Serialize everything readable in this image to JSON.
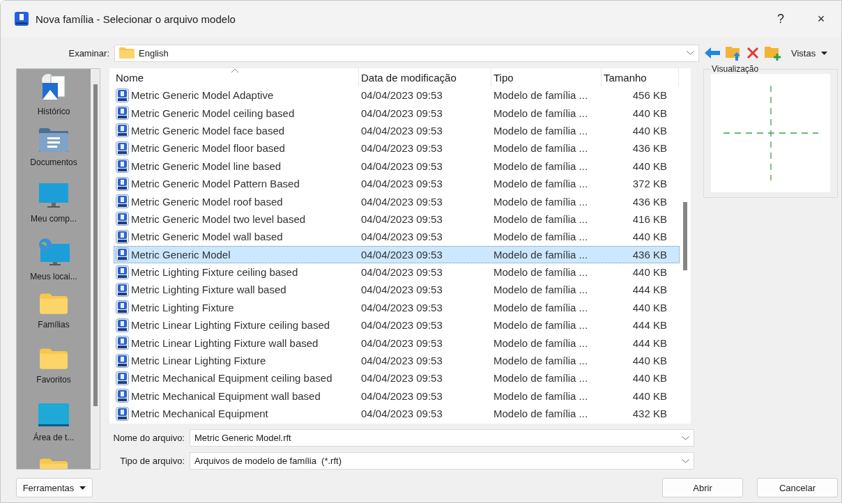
{
  "window": {
    "title": "Nova família - Selecionar o arquivo modelo",
    "help": "?",
    "close": "×"
  },
  "look_in": {
    "label": "Examinar:",
    "value": "English"
  },
  "toolbar": {
    "views": "Vistas"
  },
  "sidebar": {
    "items": [
      {
        "label": "Histórico",
        "kind": "history"
      },
      {
        "label": "Documentos",
        "kind": "documents"
      },
      {
        "label": "Meu comp...",
        "kind": "computer"
      },
      {
        "label": "Meus locai...",
        "kind": "network"
      },
      {
        "label": "Famílias",
        "kind": "folder"
      },
      {
        "label": "Favoritos",
        "kind": "folder"
      },
      {
        "label": "Área de t...",
        "kind": "desktop"
      },
      {
        "kind": "folder"
      }
    ]
  },
  "table": {
    "columns": [
      "Nome",
      "Data de modificação",
      "Tipo",
      "Tamanho"
    ],
    "rows": [
      {
        "name": "Metric Generic Model Adaptive",
        "date": "04/04/2023 09:53",
        "type": "Modelo de família ...",
        "size": "456 KB",
        "selected": false
      },
      {
        "name": "Metric Generic Model ceiling based",
        "date": "04/04/2023 09:53",
        "type": "Modelo de família ...",
        "size": "440 KB",
        "selected": false
      },
      {
        "name": "Metric Generic Model face based",
        "date": "04/04/2023 09:53",
        "type": "Modelo de família ...",
        "size": "440 KB",
        "selected": false
      },
      {
        "name": "Metric Generic Model floor based",
        "date": "04/04/2023 09:53",
        "type": "Modelo de família ...",
        "size": "436 KB",
        "selected": false
      },
      {
        "name": "Metric Generic Model line based",
        "date": "04/04/2023 09:53",
        "type": "Modelo de família ...",
        "size": "440 KB",
        "selected": false
      },
      {
        "name": "Metric Generic Model Pattern Based",
        "date": "04/04/2023 09:53",
        "type": "Modelo de família ...",
        "size": "372 KB",
        "selected": false
      },
      {
        "name": "Metric Generic Model roof based",
        "date": "04/04/2023 09:53",
        "type": "Modelo de família ...",
        "size": "436 KB",
        "selected": false
      },
      {
        "name": "Metric Generic Model two level based",
        "date": "04/04/2023 09:53",
        "type": "Modelo de família ...",
        "size": "416 KB",
        "selected": false
      },
      {
        "name": "Metric Generic Model wall based",
        "date": "04/04/2023 09:53",
        "type": "Modelo de família ...",
        "size": "440 KB",
        "selected": false
      },
      {
        "name": "Metric Generic Model",
        "date": "04/04/2023 09:53",
        "type": "Modelo de família ...",
        "size": "436 KB",
        "selected": true
      },
      {
        "name": "Metric Lighting Fixture ceiling based",
        "date": "04/04/2023 09:53",
        "type": "Modelo de família ...",
        "size": "440 KB",
        "selected": false
      },
      {
        "name": "Metric Lighting Fixture wall based",
        "date": "04/04/2023 09:53",
        "type": "Modelo de família ...",
        "size": "444 KB",
        "selected": false
      },
      {
        "name": "Metric Lighting Fixture",
        "date": "04/04/2023 09:53",
        "type": "Modelo de família ...",
        "size": "440 KB",
        "selected": false
      },
      {
        "name": "Metric Linear Lighting Fixture ceiling based",
        "date": "04/04/2023 09:53",
        "type": "Modelo de família ...",
        "size": "444 KB",
        "selected": false
      },
      {
        "name": "Metric Linear Lighting Fixture wall based",
        "date": "04/04/2023 09:53",
        "type": "Modelo de família ...",
        "size": "444 KB",
        "selected": false
      },
      {
        "name": "Metric Linear Lighting Fixture",
        "date": "04/04/2023 09:53",
        "type": "Modelo de família ...",
        "size": "440 KB",
        "selected": false
      },
      {
        "name": "Metric Mechanical Equipment ceiling based",
        "date": "04/04/2023 09:53",
        "type": "Modelo de família ...",
        "size": "440 KB",
        "selected": false
      },
      {
        "name": "Metric Mechanical Equipment wall based",
        "date": "04/04/2023 09:53",
        "type": "Modelo de família ...",
        "size": "440 KB",
        "selected": false
      },
      {
        "name": "Metric Mechanical Equipment",
        "date": "04/04/2023 09:53",
        "type": "Modelo de família ...",
        "size": "432 KB",
        "selected": false
      }
    ]
  },
  "preview": {
    "label": "Visualização"
  },
  "file_name": {
    "label": "Nome do arquivo:",
    "value": "Metric Generic Model.rft"
  },
  "file_type": {
    "label": "Tipo de arquivo:",
    "value": "Arquivos de modelo de família  (*.rft)"
  },
  "buttons": {
    "tools": "Ferramentas",
    "open": "Abrir",
    "cancel": "Cancelar"
  }
}
